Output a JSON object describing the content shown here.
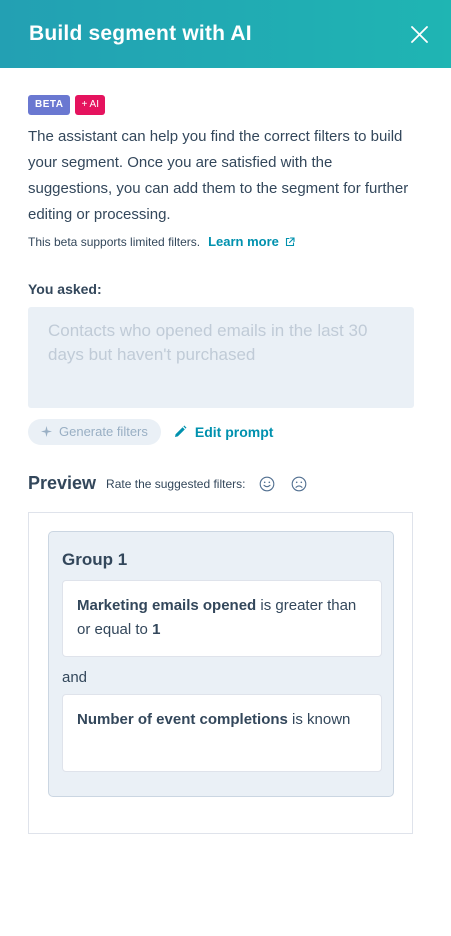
{
  "header": {
    "title": "Build segment with AI"
  },
  "badges": {
    "beta": "BETA",
    "ai": "+ AI"
  },
  "description": "The assistant can help you find the correct filters to build your segment. Once you are satisfied with the suggestions, you can add them to the segment for further editing or processing.",
  "note": {
    "text": "This beta supports limited filters.",
    "link": "Learn more"
  },
  "asked": {
    "label": "You asked:",
    "placeholder": "Contacts who opened emails in the last 30 days but haven't purchased"
  },
  "actions": {
    "generate": "Generate filters",
    "edit": "Edit prompt"
  },
  "preview": {
    "title": "Preview",
    "rate_label": "Rate the suggested filters:",
    "group": {
      "title": "Group 1",
      "filters": [
        {
          "property": "Marketing emails opened",
          "operator": " is greater than or equal to ",
          "value": "1"
        },
        {
          "property": "Number of event completions",
          "operator": " is known"
        }
      ],
      "connector": "and"
    }
  },
  "colors": {
    "header": "#23a0b3",
    "link": "#0091ae",
    "beta": "#6a78d1",
    "ai": "#e5135e"
  }
}
